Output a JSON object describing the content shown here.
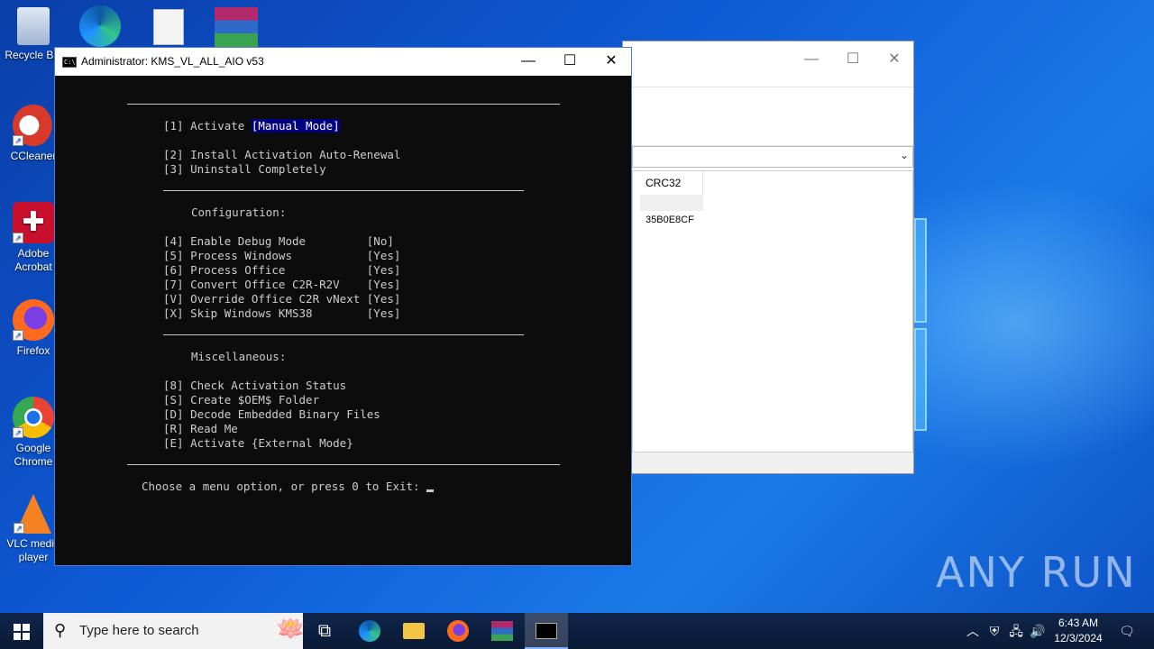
{
  "desktop": {
    "icons": [
      {
        "label": "Recycle Bin"
      },
      {
        "label": "CCleaner"
      },
      {
        "label": "Adobe Acrobat"
      },
      {
        "label": "Firefox"
      },
      {
        "label": "Google Chrome"
      },
      {
        "label": "VLC media player"
      }
    ]
  },
  "bg_window": {
    "column_header": "CRC32",
    "cell_value": "35B0E8CF"
  },
  "console": {
    "title": "Administrator:  KMS_VL_ALL_AIO v53",
    "lines": {
      "opt1_prefix": "[1] Activate ",
      "opt1_mode": "[Manual Mode]",
      "opt2": "[2] Install Activation Auto-Renewal",
      "opt3": "[3] Uninstall Completely",
      "config_header": "Configuration:",
      "opt4": "[4] Enable Debug Mode         [No]",
      "opt5": "[5] Process Windows           [Yes]",
      "opt6": "[6] Process Office            [Yes]",
      "opt7": "[7] Convert Office C2R-R2V    [Yes]",
      "optV": "[V] Override Office C2R vNext [Yes]",
      "optX": "[X] Skip Windows KMS38        [Yes]",
      "misc_header": "Miscellaneous:",
      "opt8": "[8] Check Activation Status",
      "optS": "[S] Create $OEM$ Folder",
      "optD": "[D] Decode Embedded Binary Files",
      "optR": "[R] Read Me",
      "optE": "[E] Activate {External Mode}",
      "prompt": "Choose a menu option, or press 0 to Exit: "
    }
  },
  "taskbar": {
    "search_placeholder": "Type here to search",
    "clock_time": "6:43 AM",
    "clock_date": "12/3/2024"
  },
  "watermark": "ANY RUN"
}
